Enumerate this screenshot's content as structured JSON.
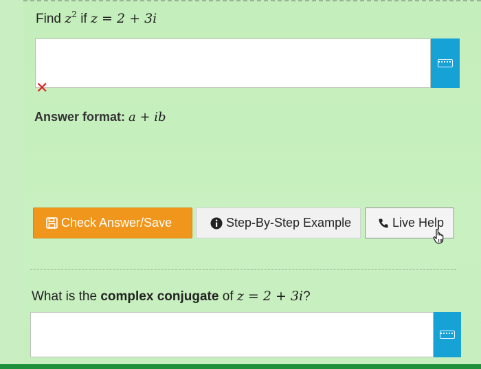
{
  "question1": {
    "prefix": "Find",
    "var": "z",
    "exp": "2",
    "mid": "if",
    "equation": "z = 2 + 3i"
  },
  "answer_format": {
    "label": "Answer format:",
    "value": "a + ib"
  },
  "buttons": {
    "check": "Check Answer/Save",
    "step": "Step-By-Step Example",
    "help": "Live Help"
  },
  "question2": {
    "prefix": "What is the",
    "bold": "complex conjugate",
    "mid": "of",
    "equation": "z = 2 + 3i",
    "suffix": "?"
  },
  "colors": {
    "background": "#c8f0c0",
    "keyboard_button": "#17a2d6",
    "check_button": "#f0961c",
    "error_mark": "#e01e1e"
  },
  "icons": [
    "keyboard-icon",
    "x-mark-icon",
    "save-icon",
    "info-icon",
    "phone-icon",
    "hand-cursor-icon"
  ]
}
